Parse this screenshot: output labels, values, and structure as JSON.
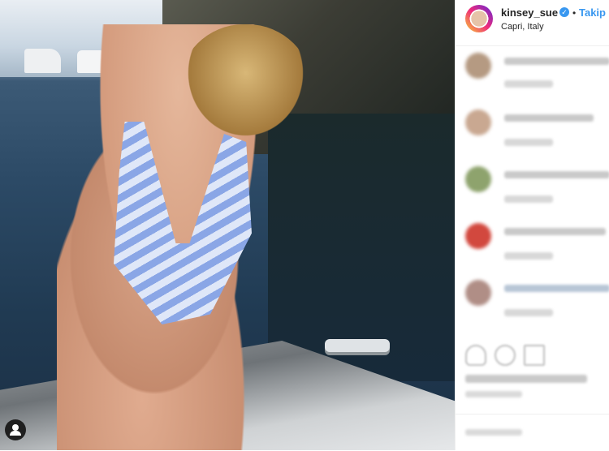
{
  "post": {
    "username": "kinsey_sue",
    "verified_mark": "✓",
    "separator": "•",
    "follow_label": "Takip",
    "location": "Capri, Italy"
  },
  "icons": {
    "verified": "verified-badge-icon",
    "tagged_user": "user-tag-icon",
    "like": "heart-icon",
    "comment": "comment-icon",
    "share": "share-icon"
  },
  "colors": {
    "accent": "#3897f0",
    "text": "#262626",
    "border": "#efefef"
  }
}
